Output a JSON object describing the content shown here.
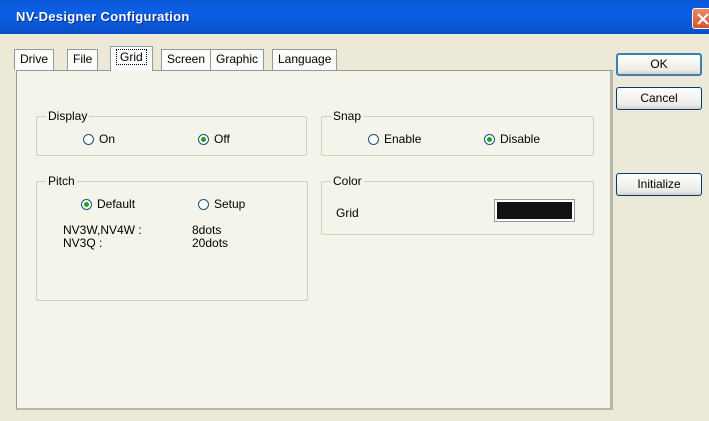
{
  "window": {
    "title": "NV-Designer Configuration",
    "colors": {
      "title_bar": "#0b5fe6",
      "close_button": "#d8512e",
      "background": "#ece9d8"
    }
  },
  "tabs": [
    {
      "label": "Drive",
      "active": false
    },
    {
      "label": "File",
      "active": false
    },
    {
      "label": "Grid",
      "active": true
    },
    {
      "label": "Screen",
      "active": false
    },
    {
      "label": "Graphic",
      "active": false
    },
    {
      "label": "Language",
      "active": false
    }
  ],
  "display": {
    "title": "Display",
    "options": [
      {
        "label": "On",
        "selected": false
      },
      {
        "label": "Off",
        "selected": true
      }
    ]
  },
  "snap": {
    "title": "Snap",
    "options": [
      {
        "label": "Enable",
        "selected": false
      },
      {
        "label": "Disable",
        "selected": true
      }
    ]
  },
  "pitch": {
    "title": "Pitch",
    "options": [
      {
        "label": "Default",
        "selected": true
      },
      {
        "label": "Setup",
        "selected": false
      }
    ],
    "rows": [
      {
        "model": "NV3W,NV4W :",
        "value": "8dots"
      },
      {
        "model": "NV3Q :",
        "value": "20dots"
      }
    ]
  },
  "color": {
    "title": "Color",
    "grid_label": "Grid",
    "grid_color": "#111111"
  },
  "buttons": {
    "ok": "OK",
    "cancel": "Cancel",
    "initialize": "Initialize"
  }
}
